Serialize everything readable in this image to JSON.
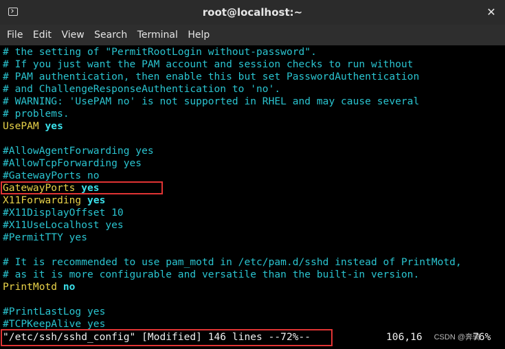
{
  "window": {
    "title": "root@localhost:~"
  },
  "menu": {
    "items": [
      "File",
      "Edit",
      "View",
      "Search",
      "Terminal",
      "Help"
    ]
  },
  "editor": {
    "lines": [
      {
        "text": "# the setting of \"PermitRootLogin without-password\"."
      },
      {
        "text": "# If you just want the PAM account and session checks to run without"
      },
      {
        "text": "# PAM authentication, then enable this but set PasswordAuthentication"
      },
      {
        "text": "# and ChallengeResponseAuthentication to 'no'."
      },
      {
        "text": "# WARNING: 'UsePAM no' is not supported in RHEL and may cause several"
      },
      {
        "text": "# problems."
      },
      {
        "key": "UsePAM",
        "value": "yes"
      },
      {
        "text": ""
      },
      {
        "text": "#AllowAgentForwarding yes"
      },
      {
        "text": "#AllowTcpForwarding yes"
      },
      {
        "text": "#GatewayPorts no"
      },
      {
        "key": "GatewayPorts",
        "value": "yes"
      },
      {
        "key": "X11Forwarding",
        "value": "yes"
      },
      {
        "text": "#X11DisplayOffset 10"
      },
      {
        "text": "#X11UseLocalhost yes"
      },
      {
        "text": "#PermitTTY yes"
      },
      {
        "text": ""
      },
      {
        "text": "# It is recommended to use pam_motd in /etc/pam.d/sshd instead of PrintMotd,"
      },
      {
        "text": "# as it is more configurable and versatile than the built-in version."
      },
      {
        "key": "PrintMotd",
        "value": "no"
      },
      {
        "text": ""
      },
      {
        "text": "#PrintLastLog yes"
      },
      {
        "text": "#TCPKeepAlive yes"
      }
    ]
  },
  "statusbar": {
    "message": "\"/etc/ssh/sshd_config\" [Modified] 146 lines --72%--",
    "cursor": "106,16",
    "percent": "76%"
  },
  "watermark": "CSDN @奔骑",
  "colors": {
    "comment": "#2ac4d0",
    "keyword": "#e9d34a",
    "value": "#3be0ea",
    "highlight": "#e23434"
  }
}
